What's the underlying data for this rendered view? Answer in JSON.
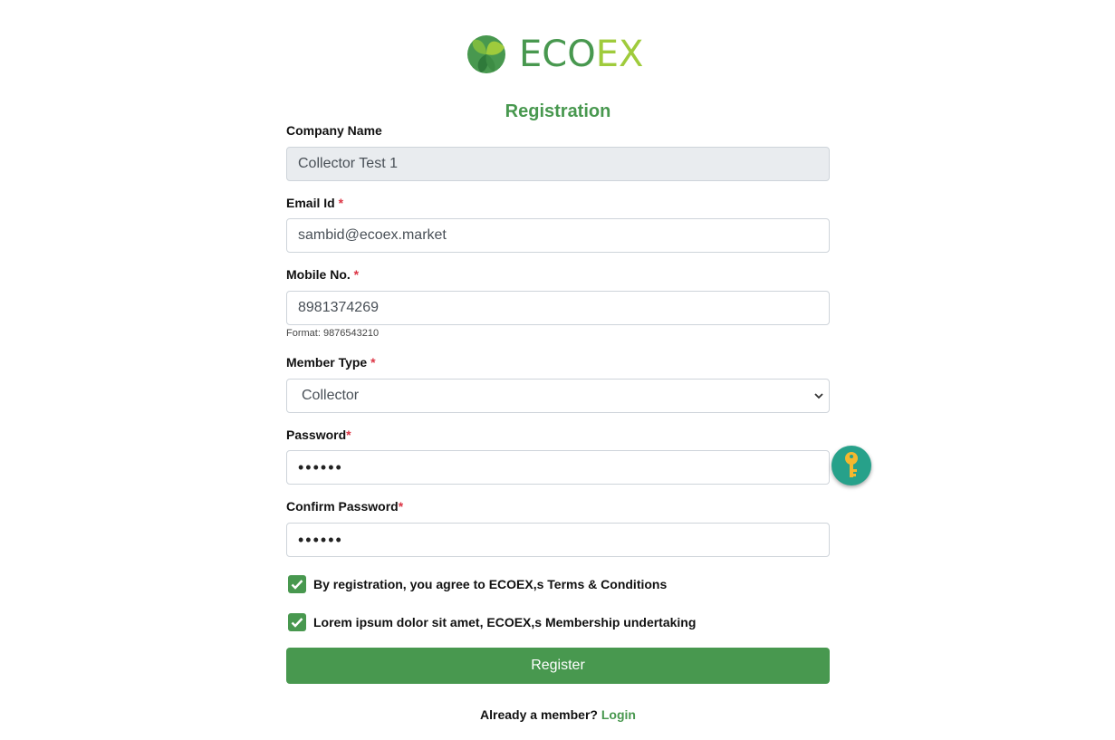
{
  "brand": {
    "logo_part1": "ECO",
    "logo_part2": "EX",
    "primary_color": "#48984f",
    "accent_color": "#9fcb3c"
  },
  "page": {
    "title": "Registration"
  },
  "form": {
    "company_name": {
      "label": "Company Name",
      "value": "Collector Test 1"
    },
    "email": {
      "label": "Email Id",
      "required_mark": "*",
      "value": "sambid@ecoex.market"
    },
    "mobile": {
      "label": "Mobile No.",
      "required_mark": "*",
      "value": "8981374269",
      "help": "Format: 9876543210"
    },
    "member_type": {
      "label": "Member Type",
      "required_mark": "*",
      "value": "Collector"
    },
    "password": {
      "label": "Password",
      "required_mark": "*",
      "value": "••••••"
    },
    "confirm_password": {
      "label": "Confirm Password",
      "required_mark": "*",
      "value": "••••••"
    },
    "terms_check": {
      "label": "By registration, you agree to ECOEX,s Terms & Conditions",
      "checked": true
    },
    "membership_check": {
      "label": "Lorem ipsum dolor sit amet, ECOEX,s Membership undertaking",
      "checked": true
    },
    "register_label": "Register"
  },
  "footer": {
    "prompt": "Already a member?",
    "login_label": "Login"
  },
  "icons": {
    "generate_password": "key-icon"
  }
}
